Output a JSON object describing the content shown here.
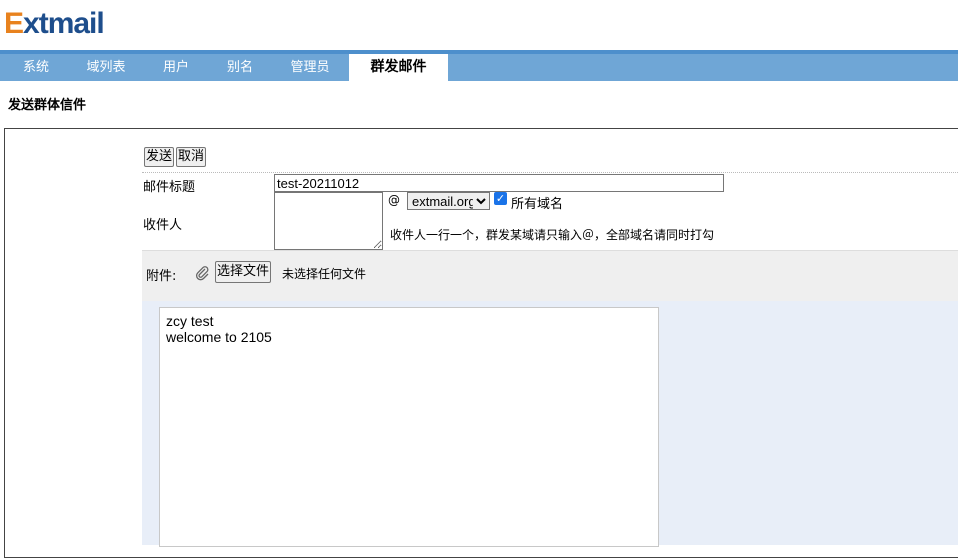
{
  "app": {
    "logo_first": "E",
    "logo_rest": "xtmail"
  },
  "nav": {
    "items": [
      "系统",
      "域列表",
      "用户",
      "别名",
      "管理员",
      "群发邮件"
    ],
    "active": "群发邮件"
  },
  "page": {
    "title": "发送群体信件"
  },
  "form": {
    "send_label": "发送",
    "cancel_label": "取消",
    "subject_label": "邮件标题",
    "subject_value": "test-20211012",
    "recipients_label": "收件人",
    "at_sign": "@",
    "domain_selected": "extmail.org",
    "all_domains_label": "所有域名",
    "all_domains_checked": true,
    "hint": "收件人一行一个，群发某域请只输入＠，全部域名请同时打勾",
    "attach_label": "附件:",
    "choose_file_label": "选择文件",
    "no_file_text": "未选择任何文件",
    "body_lines": [
      "zcy test",
      "welcome to 2105"
    ]
  },
  "colors": {
    "nav_bg": "#6fa6d6",
    "logo_orange": "#e8821e",
    "logo_blue": "#1e4e8c",
    "editor_bg": "#e8eef8"
  }
}
